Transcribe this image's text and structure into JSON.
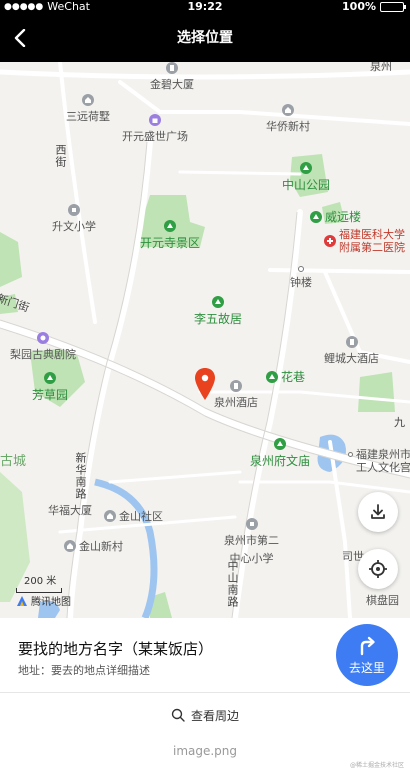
{
  "status_bar": {
    "signal": "●●●●●",
    "carrier": "WeChat",
    "time": "19:22",
    "battery": "100%",
    "battery_level": 1.0
  },
  "nav": {
    "title": "选择位置",
    "back_icon": "chevron-left-icon"
  },
  "map": {
    "labels": {
      "top_right_road": "泉州",
      "jinbi": "金碧大厦",
      "sanyun": "三远荷墅",
      "kaiyuan_plaza": "开元盛世广场",
      "huaqiao": "华侨新村",
      "xijie": "西街",
      "zhongshan_park": "中山公园",
      "shengwen": "升文小学",
      "weiyuan": "威远楼",
      "kaiyuansi": "开元寺景区",
      "hospital_1": "福建医科大学",
      "hospital_2": "附属第二医院",
      "zhonglou": "钟楼",
      "ximen": "新门街",
      "liwu": "李五故居",
      "liyuan": "梨园古典剧院",
      "licheng": "鲤城大酒店",
      "huaxiang": "花巷",
      "fangcao": "芳草园",
      "quanzhou_hotel": "泉州酒店",
      "jiu": "九",
      "gucheng": "古城",
      "wenmiao": "泉州府文庙",
      "worker_1": "福建泉州市",
      "worker_2": "工人文化宫",
      "xinhua": "新华南路",
      "huafu": "华福大厦",
      "jinshan_community": "金山社区",
      "school2_1": "泉州市第二",
      "school2_2": "中心小学",
      "jinshan_village": "金山新村",
      "zhongshan_road": "中山南路",
      "sidui": "司世",
      "qipan": "棋盘园"
    },
    "scale_label": "200 米",
    "logo_text": "腾讯地图",
    "download_icon": "download-icon",
    "locate_icon": "locate-target-icon",
    "pin_icon": "map-pin-icon"
  },
  "info": {
    "name": "要找的地方名字（某某饭店）",
    "address": "地址：要去的地点详细描述",
    "go_label": "去这里",
    "go_icon": "turn-right-arrow-icon"
  },
  "nearby": {
    "label": "查看周边",
    "icon": "search-icon"
  },
  "caption": "image.png",
  "watermark": "@稀土掘金技术社区",
  "colors": {
    "nav_bg": "#000000",
    "accent": "#3d7cf2",
    "pin": "#e8421f",
    "park": "#bfe3b4",
    "water": "#9ec5f0"
  }
}
